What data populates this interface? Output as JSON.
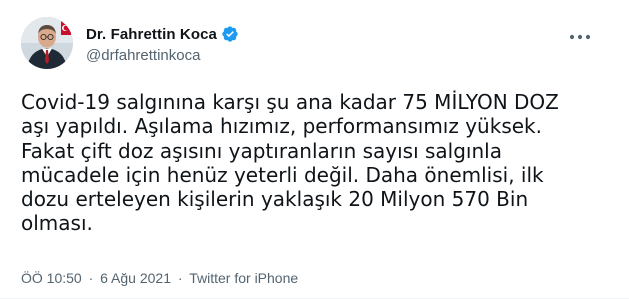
{
  "tweet": {
    "author": {
      "display_name": "Dr. Fahrettin Koca",
      "handle": "@drfahrettinkoca",
      "verified": true,
      "verified_icon": "verified-badge-icon",
      "verified_color": "#1d9bf0"
    },
    "text": "Covid-19 salgınına karşı şu ana kadar 75 MİLYON DOZ\naşı yapıldı. Aşılama hızımız, performansımız yüksek.\nFakat çift doz aşısını yaptıranların sayısı salgınla\nmücadele için henüz yeterli değil. Daha önemlisi, ilk\ndozu erteleyen kişilerin yaklaşık 20 Milyon 570 Bin\nolması.",
    "time": "ÖÖ 10:50",
    "separator": "·",
    "date": "6 Ağu 2021",
    "source": "Twitter for iPhone",
    "more_icon": "more-options-icon"
  }
}
